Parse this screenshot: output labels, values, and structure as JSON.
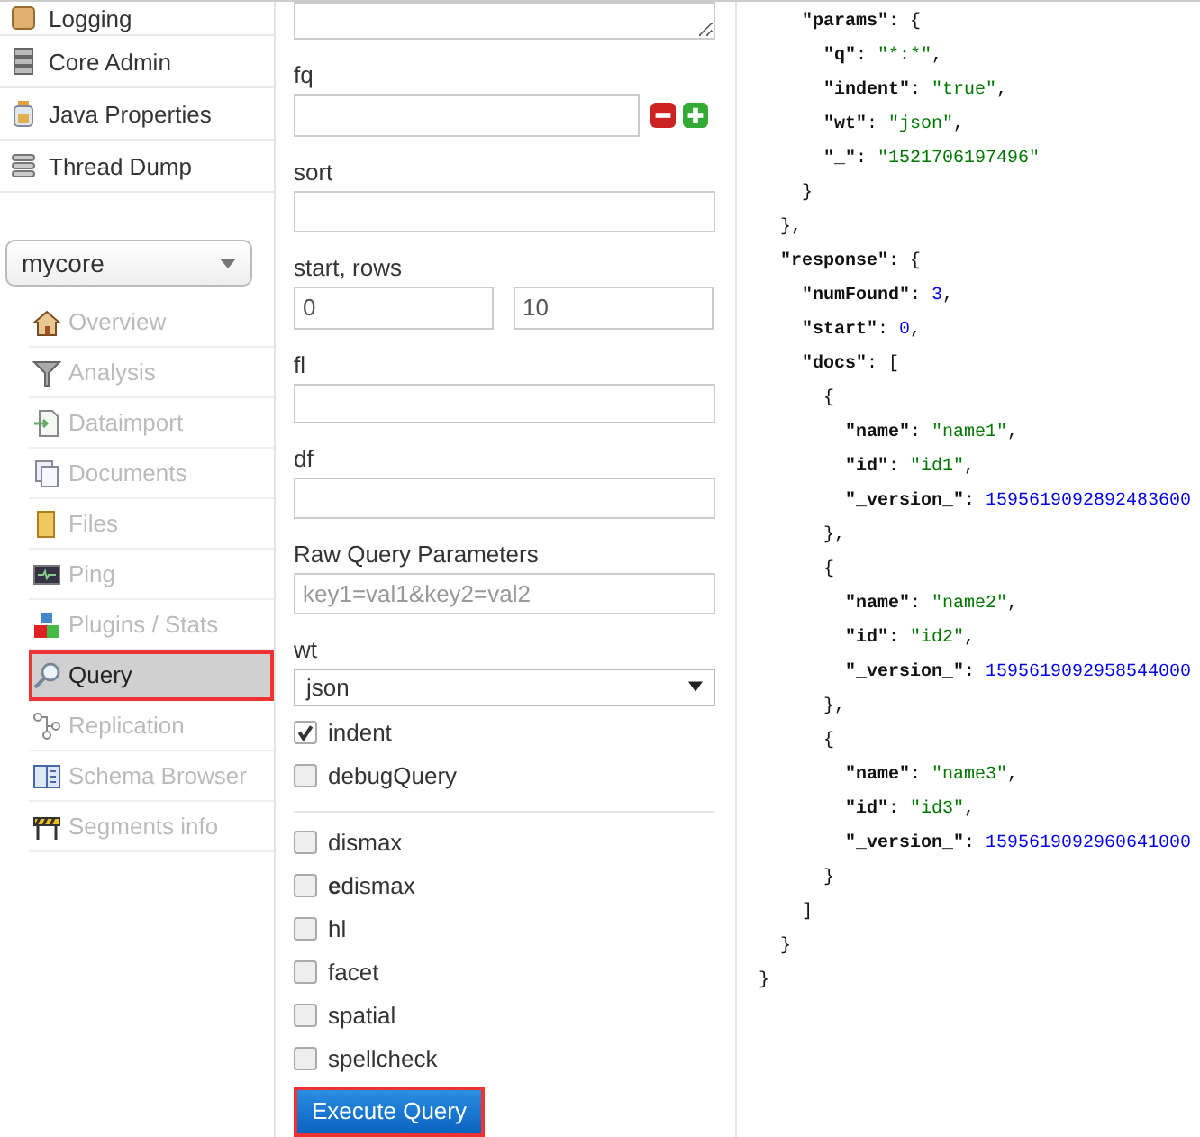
{
  "sidebar": {
    "admin_items": [
      {
        "label": "Logging"
      },
      {
        "label": "Core Admin"
      },
      {
        "label": "Java Properties"
      },
      {
        "label": "Thread Dump"
      }
    ],
    "core_selector": {
      "value": "mycore"
    },
    "core_items": [
      {
        "label": "Overview",
        "selected": false,
        "annotated": false
      },
      {
        "label": "Analysis",
        "selected": false,
        "annotated": false
      },
      {
        "label": "Dataimport",
        "selected": false,
        "annotated": false
      },
      {
        "label": "Documents",
        "selected": false,
        "annotated": false
      },
      {
        "label": "Files",
        "selected": false,
        "annotated": false
      },
      {
        "label": "Ping",
        "selected": false,
        "annotated": false
      },
      {
        "label": "Plugins / Stats",
        "selected": false,
        "annotated": false
      },
      {
        "label": "Query",
        "selected": true,
        "annotated": true
      },
      {
        "label": "Replication",
        "selected": false,
        "annotated": false
      },
      {
        "label": "Schema Browser",
        "selected": false,
        "annotated": false
      },
      {
        "label": "Segments info",
        "selected": false,
        "annotated": false
      }
    ]
  },
  "query_form": {
    "fields": [
      {
        "kind": "filter",
        "label": "fq"
      },
      {
        "kind": "text",
        "label": "sort"
      },
      {
        "kind": "pair",
        "label": "start, rows",
        "value": "0",
        "value_2": "10"
      },
      {
        "kind": "text",
        "label": "fl"
      },
      {
        "kind": "text",
        "label": "df"
      },
      {
        "kind": "text",
        "label": "Raw Query Parameters",
        "placeholder": "key1=val1&key2=val2"
      },
      {
        "kind": "select",
        "label": "wt",
        "value": "json"
      }
    ],
    "options": [
      {
        "label": "indent",
        "checked": true
      },
      {
        "label": "debugQuery",
        "checked": false
      }
    ],
    "handlers": [
      {
        "label": "dismax",
        "checked": false
      },
      {
        "label": "**e**dismax",
        "checked": false
      },
      {
        "label": "hl",
        "checked": false
      },
      {
        "label": "facet",
        "checked": false
      },
      {
        "label": "spatial",
        "checked": false
      },
      {
        "label": "spellcheck",
        "checked": false
      }
    ],
    "execute_button": {
      "label": "Execute Query",
      "annotated": true
    }
  },
  "response_output": {
    "lines": [
      {
        "close": "}",
        "children": [
          {
            "close": "},",
            "children": [
              {
                "key": "\"params\"",
                "sep": ": {",
                "close": "}",
                "children": [
                  {
                    "key": "\"q\"",
                    "sep": ": ",
                    "value": "\"*:*\"",
                    "tail": ",",
                    "kind": "string"
                  },
                  {
                    "key": "\"indent\"",
                    "sep": ": ",
                    "value": "\"true\"",
                    "tail": ",",
                    "kind": "string"
                  },
                  {
                    "key": "\"wt\"",
                    "sep": ": ",
                    "value": "\"json\"",
                    "tail": ",",
                    "kind": "string"
                  },
                  {
                    "key": "\"_\"",
                    "sep": ": ",
                    "value": "\"1521706197496\"",
                    "kind": "string"
                  }
                ]
              }
            ]
          },
          {
            "key": "\"response\"",
            "sep": ": {",
            "close": "}",
            "children": [
              {
                "key": "\"numFound\"",
                "sep": ": ",
                "value": "3",
                "tail": ",",
                "kind": "number"
              },
              {
                "key": "\"start\"",
                "sep": ": ",
                "value": "0",
                "tail": ",",
                "kind": "number"
              },
              {
                "key": "\"docs\"",
                "sep": ": [",
                "close": "]",
                "children": [
                  {
                    "sep": "{",
                    "close": "},",
                    "children": [
                      {
                        "key": "\"name\"",
                        "sep": ": ",
                        "value": "\"name1\"",
                        "tail": ",",
                        "kind": "string"
                      },
                      {
                        "key": "\"id\"",
                        "sep": ": ",
                        "value": "\"id1\"",
                        "tail": ",",
                        "kind": "string"
                      },
                      {
                        "key": "\"_version_\"",
                        "sep": ": ",
                        "value": "1595619092892483600",
                        "kind": "number"
                      }
                    ]
                  },
                  {
                    "sep": "{",
                    "close": "},",
                    "children": [
                      {
                        "key": "\"name\"",
                        "sep": ": ",
                        "value": "\"name2\"",
                        "tail": ",",
                        "kind": "string"
                      },
                      {
                        "key": "\"id\"",
                        "sep": ": ",
                        "value": "\"id2\"",
                        "tail": ",",
                        "kind": "string"
                      },
                      {
                        "key": "\"_version_\"",
                        "sep": ": ",
                        "value": "1595619092958544000",
                        "kind": "number"
                      }
                    ]
                  },
                  {
                    "sep": "{",
                    "close": "}",
                    "children": [
                      {
                        "key": "\"name\"",
                        "sep": ": ",
                        "value": "\"name3\"",
                        "tail": ",",
                        "kind": "string"
                      },
                      {
                        "key": "\"id\"",
                        "sep": ": ",
                        "value": "\"id3\"",
                        "tail": ",",
                        "kind": "string"
                      },
                      {
                        "key": "\"_version_\"",
                        "sep": ": ",
                        "value": "1595619092960641000",
                        "kind": "number"
                      }
                    ]
                  }
                ]
              }
            ]
          }
        ]
      }
    ]
  }
}
